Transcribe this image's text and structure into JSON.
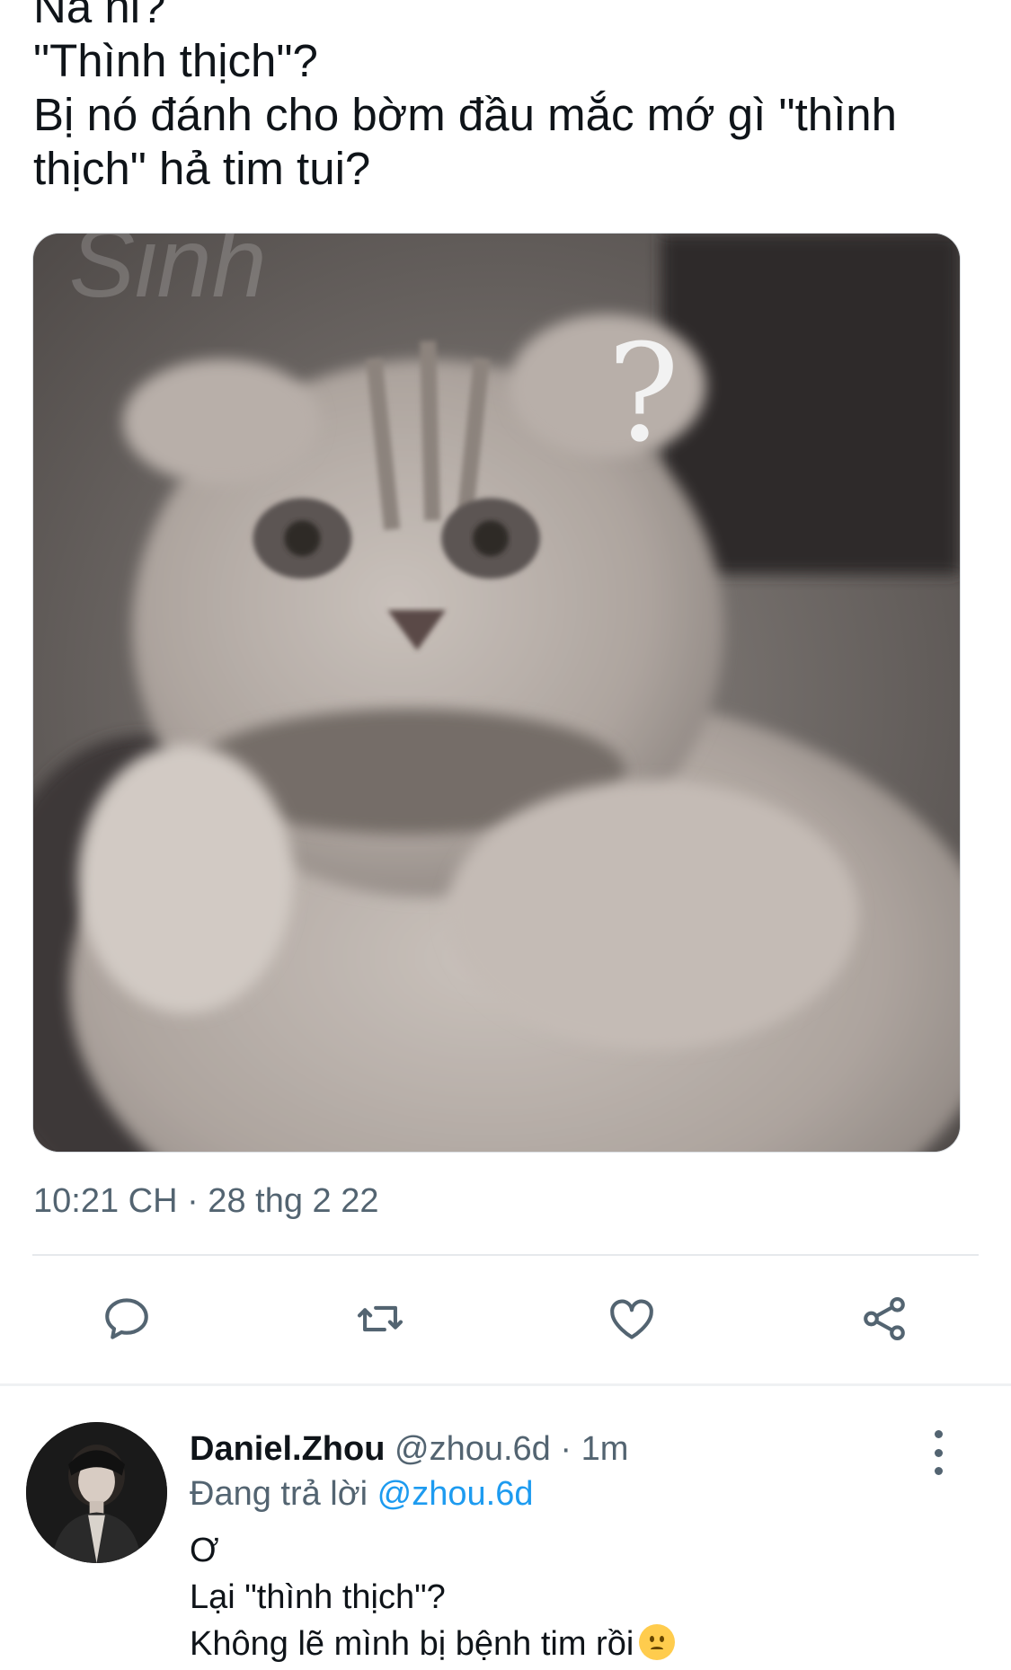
{
  "tweet": {
    "lines": [
      "Na ni?",
      "\"Thình thịch\"?",
      "Bị nó đánh cho bờm đầu mắc mớ gì \"thình",
      "thịch\" hả tim tui?"
    ],
    "media": {
      "watermark": "Sinh",
      "overlay_symbol": "?"
    },
    "timestamp": "10:21 CH · 28 thg 2 22"
  },
  "actions": {
    "reply_icon": "reply-bubble-icon",
    "retweet_icon": "retweet-icon",
    "like_icon": "heart-icon",
    "share_icon": "share-icon"
  },
  "reply": {
    "name": "Daniel.Zhou",
    "handle": "@zhou.6d · 1m",
    "replying_label": "Đang trả lời",
    "replying_mention": "@zhou.6d",
    "lines": [
      "Ơ",
      "Lại \"thình thịch\"?",
      "Không lẽ mình bị bệnh tim rồi"
    ],
    "emoji": "worried-face-emoji"
  },
  "colors": {
    "secondary_text": "#536471",
    "link": "#1d9bf0",
    "primary_text": "#0f1419"
  }
}
